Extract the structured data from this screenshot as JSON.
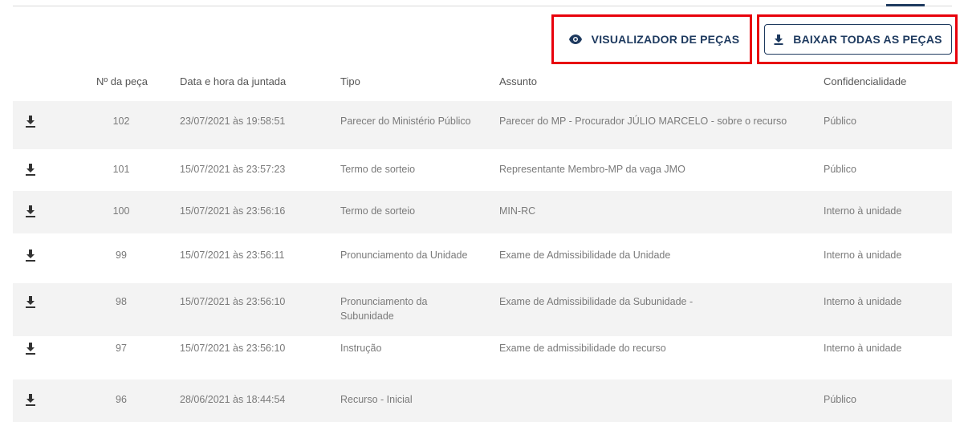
{
  "toolbar": {
    "view_label": "VISUALIZADOR DE PEÇAS",
    "download_all_label": "BAIXAR TODAS AS PEÇAS"
  },
  "table": {
    "headers": {
      "num": "Nº da peça",
      "date": "Data e hora da juntada",
      "tipo": "Tipo",
      "assunto": "Assunto",
      "conf": "Confidencialidade"
    },
    "rows": [
      {
        "num": "102",
        "date": "23/07/2021 às 19:58:51",
        "tipo": "Parecer do Ministério Público",
        "assunto": "Parecer do MP - Procurador JÚLIO MARCELO - sobre o recurso",
        "conf": "Público"
      },
      {
        "num": "101",
        "date": "15/07/2021 às 23:57:23",
        "tipo": "Termo de sorteio",
        "assunto": "Representante Membro-MP da vaga JMO",
        "conf": "Público"
      },
      {
        "num": "100",
        "date": "15/07/2021 às 23:56:16",
        "tipo": "Termo de sorteio",
        "assunto": "MIN-RC",
        "conf": "Interno à unidade"
      },
      {
        "num": "99",
        "date": "15/07/2021 às 23:56:11",
        "tipo": "Pronunciamento da Unidade",
        "assunto": "Exame de Admissibilidade da Unidade",
        "conf": "Interno à unidade"
      },
      {
        "num": "98",
        "date": "15/07/2021 às 23:56:10",
        "tipo": "Pronunciamento da Subunidade",
        "assunto": "Exame de Admissibilidade da Subunidade -",
        "conf": "Interno à unidade"
      },
      {
        "num": "97",
        "date": "15/07/2021 às 23:56:10",
        "tipo": "Instrução",
        "assunto": "Exame de admissibilidade do recurso",
        "conf": "Interno à unidade"
      },
      {
        "num": "96",
        "date": "28/06/2021 às 18:44:54",
        "tipo": "Recurso - Inicial",
        "assunto": "",
        "conf": "Público"
      }
    ]
  },
  "colors": {
    "accent": "#1e3a5f",
    "highlight": "#e8000b",
    "row_shade": "#f3f3f3"
  },
  "icons": {
    "view": "eye-icon",
    "download": "download-icon"
  }
}
